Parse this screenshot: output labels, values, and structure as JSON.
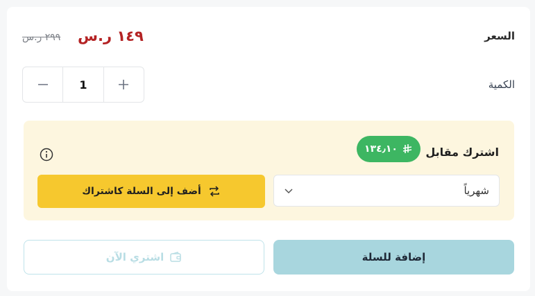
{
  "price": {
    "label": "السعر",
    "current": "١٤٩ ر.س",
    "old": "٢٩٩ ر.س"
  },
  "quantity": {
    "label": "الكمية",
    "value": "1",
    "minus_icon": "minus-icon",
    "plus_icon": "plus-icon"
  },
  "subscription": {
    "title": "اشترك مقابل",
    "badge_amount": "١٣٤٫١٠",
    "period_selected": "شهرياً",
    "add_button_label": "أضف إلى السلة كاشتراك",
    "colors": {
      "panel": "#fdf6df",
      "badge": "#3db662",
      "button": "#f6c82e"
    }
  },
  "actions": {
    "add_to_cart_label": "إضافة للسلة",
    "buy_now_label": "اشتري الآن"
  },
  "colors": {
    "price": "#b42324",
    "cart": "#a8d6de"
  }
}
